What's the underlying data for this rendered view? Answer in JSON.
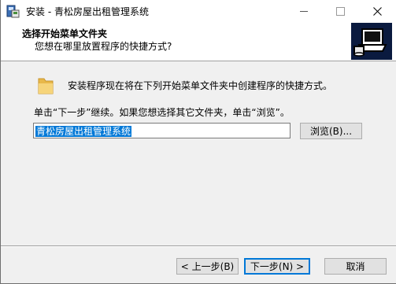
{
  "window": {
    "title": "安装 - 青松房屋出租管理系统"
  },
  "header": {
    "title": "选择开始菜单文件夹",
    "subtitle": "您想在哪里放置程序的快捷方式?"
  },
  "body": {
    "intro": "安装程序现在将在下列开始菜单文件夹中创建程序的快捷方式。",
    "instruction": "单击“下一步”继续。如果您想选择其它文件夹，单击“浏览”。",
    "folder_value": "青松房屋出租管理系统",
    "browse_label": "浏览(B)..."
  },
  "buttons": {
    "back_label": "< 上一步(B)",
    "next_label": "下一步(N) >",
    "cancel_label": "取消"
  },
  "icons": {
    "app": "installer-icon",
    "folder": "folder-icon",
    "logo": "computer-install-logo-icon"
  },
  "colors": {
    "selection": "#0078d7",
    "window_bg": "#f0f0f0",
    "header_bg": "#ffffff"
  }
}
